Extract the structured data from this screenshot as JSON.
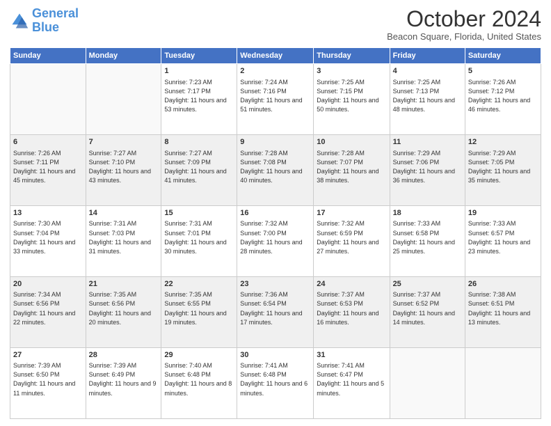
{
  "header": {
    "logo_line1": "General",
    "logo_line2": "Blue",
    "main_title": "October 2024",
    "subtitle": "Beacon Square, Florida, United States"
  },
  "days_of_week": [
    "Sunday",
    "Monday",
    "Tuesday",
    "Wednesday",
    "Thursday",
    "Friday",
    "Saturday"
  ],
  "weeks": [
    [
      {
        "day": "",
        "info": ""
      },
      {
        "day": "",
        "info": ""
      },
      {
        "day": "1",
        "info": "Sunrise: 7:23 AM\nSunset: 7:17 PM\nDaylight: 11 hours and 53 minutes."
      },
      {
        "day": "2",
        "info": "Sunrise: 7:24 AM\nSunset: 7:16 PM\nDaylight: 11 hours and 51 minutes."
      },
      {
        "day": "3",
        "info": "Sunrise: 7:25 AM\nSunset: 7:15 PM\nDaylight: 11 hours and 50 minutes."
      },
      {
        "day": "4",
        "info": "Sunrise: 7:25 AM\nSunset: 7:13 PM\nDaylight: 11 hours and 48 minutes."
      },
      {
        "day": "5",
        "info": "Sunrise: 7:26 AM\nSunset: 7:12 PM\nDaylight: 11 hours and 46 minutes."
      }
    ],
    [
      {
        "day": "6",
        "info": "Sunrise: 7:26 AM\nSunset: 7:11 PM\nDaylight: 11 hours and 45 minutes."
      },
      {
        "day": "7",
        "info": "Sunrise: 7:27 AM\nSunset: 7:10 PM\nDaylight: 11 hours and 43 minutes."
      },
      {
        "day": "8",
        "info": "Sunrise: 7:27 AM\nSunset: 7:09 PM\nDaylight: 11 hours and 41 minutes."
      },
      {
        "day": "9",
        "info": "Sunrise: 7:28 AM\nSunset: 7:08 PM\nDaylight: 11 hours and 40 minutes."
      },
      {
        "day": "10",
        "info": "Sunrise: 7:28 AM\nSunset: 7:07 PM\nDaylight: 11 hours and 38 minutes."
      },
      {
        "day": "11",
        "info": "Sunrise: 7:29 AM\nSunset: 7:06 PM\nDaylight: 11 hours and 36 minutes."
      },
      {
        "day": "12",
        "info": "Sunrise: 7:29 AM\nSunset: 7:05 PM\nDaylight: 11 hours and 35 minutes."
      }
    ],
    [
      {
        "day": "13",
        "info": "Sunrise: 7:30 AM\nSunset: 7:04 PM\nDaylight: 11 hours and 33 minutes."
      },
      {
        "day": "14",
        "info": "Sunrise: 7:31 AM\nSunset: 7:03 PM\nDaylight: 11 hours and 31 minutes."
      },
      {
        "day": "15",
        "info": "Sunrise: 7:31 AM\nSunset: 7:01 PM\nDaylight: 11 hours and 30 minutes."
      },
      {
        "day": "16",
        "info": "Sunrise: 7:32 AM\nSunset: 7:00 PM\nDaylight: 11 hours and 28 minutes."
      },
      {
        "day": "17",
        "info": "Sunrise: 7:32 AM\nSunset: 6:59 PM\nDaylight: 11 hours and 27 minutes."
      },
      {
        "day": "18",
        "info": "Sunrise: 7:33 AM\nSunset: 6:58 PM\nDaylight: 11 hours and 25 minutes."
      },
      {
        "day": "19",
        "info": "Sunrise: 7:33 AM\nSunset: 6:57 PM\nDaylight: 11 hours and 23 minutes."
      }
    ],
    [
      {
        "day": "20",
        "info": "Sunrise: 7:34 AM\nSunset: 6:56 PM\nDaylight: 11 hours and 22 minutes."
      },
      {
        "day": "21",
        "info": "Sunrise: 7:35 AM\nSunset: 6:56 PM\nDaylight: 11 hours and 20 minutes."
      },
      {
        "day": "22",
        "info": "Sunrise: 7:35 AM\nSunset: 6:55 PM\nDaylight: 11 hours and 19 minutes."
      },
      {
        "day": "23",
        "info": "Sunrise: 7:36 AM\nSunset: 6:54 PM\nDaylight: 11 hours and 17 minutes."
      },
      {
        "day": "24",
        "info": "Sunrise: 7:37 AM\nSunset: 6:53 PM\nDaylight: 11 hours and 16 minutes."
      },
      {
        "day": "25",
        "info": "Sunrise: 7:37 AM\nSunset: 6:52 PM\nDaylight: 11 hours and 14 minutes."
      },
      {
        "day": "26",
        "info": "Sunrise: 7:38 AM\nSunset: 6:51 PM\nDaylight: 11 hours and 13 minutes."
      }
    ],
    [
      {
        "day": "27",
        "info": "Sunrise: 7:39 AM\nSunset: 6:50 PM\nDaylight: 11 hours and 11 minutes."
      },
      {
        "day": "28",
        "info": "Sunrise: 7:39 AM\nSunset: 6:49 PM\nDaylight: 11 hours and 9 minutes."
      },
      {
        "day": "29",
        "info": "Sunrise: 7:40 AM\nSunset: 6:48 PM\nDaylight: 11 hours and 8 minutes."
      },
      {
        "day": "30",
        "info": "Sunrise: 7:41 AM\nSunset: 6:48 PM\nDaylight: 11 hours and 6 minutes."
      },
      {
        "day": "31",
        "info": "Sunrise: 7:41 AM\nSunset: 6:47 PM\nDaylight: 11 hours and 5 minutes."
      },
      {
        "day": "",
        "info": ""
      },
      {
        "day": "",
        "info": ""
      }
    ]
  ]
}
